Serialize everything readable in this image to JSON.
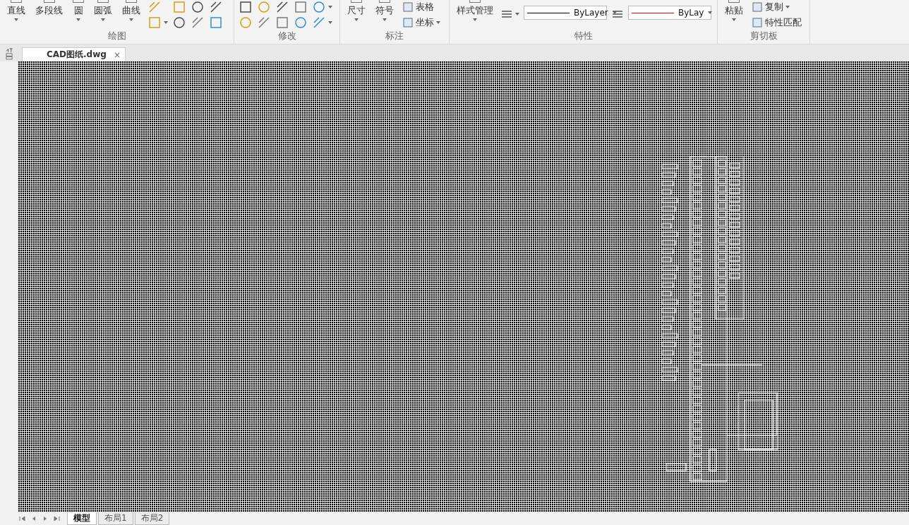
{
  "ribbon": {
    "panels": [
      {
        "title": "绘图",
        "tools": [
          {
            "kind": "large",
            "label": "直线",
            "dropdown": true
          },
          {
            "kind": "large",
            "label": "多段线",
            "dropdown": false
          },
          {
            "kind": "large",
            "label": "圆",
            "dropdown": true
          },
          {
            "kind": "large",
            "label": "圆弧",
            "dropdown": true
          },
          {
            "kind": "large",
            "label": "曲线",
            "dropdown": true
          },
          {
            "kind": "stack",
            "items": [
              {
                "kind": "icon",
                "dropdown": false
              },
              {
                "kind": "icon",
                "dropdown": true
              }
            ]
          },
          {
            "kind": "stack",
            "items": [
              {
                "kind": "icon",
                "dropdown": false
              },
              {
                "kind": "icon",
                "dropdown": false
              }
            ]
          },
          {
            "kind": "stack",
            "items": [
              {
                "kind": "icon",
                "dropdown": false
              },
              {
                "kind": "icon",
                "dropdown": false
              }
            ]
          },
          {
            "kind": "stack",
            "items": [
              {
                "kind": "icon",
                "dropdown": false
              },
              {
                "kind": "icon",
                "dropdown": false
              }
            ]
          }
        ]
      },
      {
        "title": "修改",
        "tools": [
          {
            "kind": "stack",
            "items": [
              {
                "kind": "icon",
                "dropdown": false
              },
              {
                "kind": "icon",
                "dropdown": false
              }
            ]
          },
          {
            "kind": "stack",
            "items": [
              {
                "kind": "icon",
                "dropdown": false
              },
              {
                "kind": "icon",
                "dropdown": false
              }
            ]
          },
          {
            "kind": "stack",
            "items": [
              {
                "kind": "icon",
                "dropdown": false
              },
              {
                "kind": "icon",
                "dropdown": false
              }
            ]
          },
          {
            "kind": "stack",
            "items": [
              {
                "kind": "icon",
                "dropdown": false
              },
              {
                "kind": "icon",
                "dropdown": false
              }
            ]
          },
          {
            "kind": "stack",
            "items": [
              {
                "kind": "icon",
                "dropdown": true
              },
              {
                "kind": "icon",
                "dropdown": true
              }
            ]
          }
        ]
      },
      {
        "title": "标注",
        "tools": [
          {
            "kind": "large",
            "label": "尺寸",
            "dropdown": true
          },
          {
            "kind": "large",
            "label": "符号",
            "dropdown": true
          },
          {
            "kind": "stack",
            "items": [
              {
                "kind": "small",
                "label": "表格",
                "dropdown": false
              },
              {
                "kind": "small",
                "label": "坐标",
                "dropdown": true
              }
            ]
          }
        ]
      },
      {
        "title": "特性",
        "tools": [
          {
            "kind": "large",
            "label": "样式管理",
            "dropdown": true
          },
          {
            "kind": "icon",
            "dropdown": true
          },
          {
            "kind": "combo",
            "value": "ByLayer",
            "color": "#000000"
          },
          {
            "kind": "icon",
            "dropdown": false
          },
          {
            "kind": "combo",
            "value": "ByLay",
            "color": "#ff0000"
          }
        ]
      },
      {
        "title": "剪切板",
        "tools": [
          {
            "kind": "large",
            "label": "粘贴",
            "dropdown": true
          },
          {
            "kind": "stack",
            "items": [
              {
                "kind": "small",
                "label": "复制",
                "dropdown": true
              },
              {
                "kind": "small",
                "label": "特性匹配",
                "dropdown": false
              }
            ]
          }
        ]
      }
    ]
  },
  "document_tabs": [
    {
      "label": "CAD图纸.dwg",
      "close": "×",
      "selected": true
    }
  ],
  "layout_tabs": [
    {
      "label": "模型",
      "selected": true
    },
    {
      "label": "布局1",
      "selected": false
    },
    {
      "label": "布局2",
      "selected": false
    }
  ]
}
